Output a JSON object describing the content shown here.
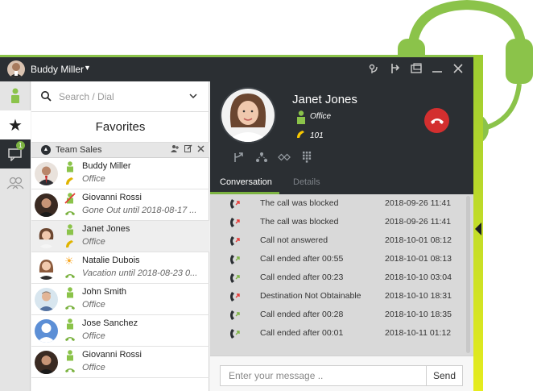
{
  "colors": {
    "accent_green": "#7cb342",
    "titlebar_dark": "#2b2f33",
    "hangup_red": "#d32f2f",
    "headset_green": "#8bc34a",
    "accent_yellow": "#e6ec1e"
  },
  "titlebar": {
    "user_name": "Buddy Miller",
    "icons": [
      "voicemail-icon",
      "call-forward-icon",
      "window-mode-icon",
      "minimize-icon",
      "close-icon"
    ]
  },
  "rail": {
    "items": [
      "presence-icon",
      "favorites-star-icon",
      "chat-icon",
      "team-icon"
    ],
    "chat_badge": "1"
  },
  "search": {
    "placeholder": "Search / Dial"
  },
  "favorites": {
    "title": "Favorites",
    "group": {
      "name": "Team Sales",
      "actions": [
        "add-member-icon",
        "edit-icon",
        "close-icon"
      ]
    }
  },
  "contacts": [
    {
      "name": "Buddy Miller",
      "sub": "Office",
      "presence": "available",
      "phone": "in-call"
    },
    {
      "name": "Giovanni Rossi",
      "sub": "Gone Out until 2018-08-17 ...",
      "presence": "away",
      "phone": "idle"
    },
    {
      "name": "Janet Jones",
      "sub": "Office",
      "presence": "available",
      "phone": "in-call"
    },
    {
      "name": "Natalie Dubois",
      "sub": "Vacation until 2018-08-23 0...",
      "presence": "vacation",
      "phone": "idle"
    },
    {
      "name": "John Smith",
      "sub": "Office",
      "presence": "available",
      "phone": "idle"
    },
    {
      "name": "Jose Sanchez",
      "sub": "Office",
      "presence": "available",
      "phone": "idle"
    },
    {
      "name": "Giovanni Rossi",
      "sub": "Office",
      "presence": "available",
      "phone": "idle"
    }
  ],
  "call": {
    "name": "Janet Jones",
    "location": "Office",
    "extension": "101",
    "actions": [
      "transfer-icon",
      "conference-icon",
      "handset-link-icon",
      "dialpad-icon"
    ]
  },
  "tabs": {
    "conversation": "Conversation",
    "details": "Details"
  },
  "history": [
    {
      "text": "The call was blocked",
      "time": "2018-09-26 11:41",
      "status": "missed"
    },
    {
      "text": "The call was blocked",
      "time": "2018-09-26 11:41",
      "status": "missed"
    },
    {
      "text": "Call not answered",
      "time": "2018-10-01 08:12",
      "status": "missed"
    },
    {
      "text": "Call ended after 00:55",
      "time": "2018-10-01 08:13",
      "status": "completed"
    },
    {
      "text": "Call ended after 00:23",
      "time": "2018-10-10 03:04",
      "status": "completed"
    },
    {
      "text": "Destination Not Obtainable",
      "time": "2018-10-10 18:31",
      "status": "missed"
    },
    {
      "text": "Call ended after 00:28",
      "time": "2018-10-10 18:35",
      "status": "completed"
    },
    {
      "text": "Call ended after 00:01",
      "time": "2018-10-11 01:12",
      "status": "completed"
    }
  ],
  "composer": {
    "placeholder": "Enter your message ..",
    "send_label": "Send"
  }
}
